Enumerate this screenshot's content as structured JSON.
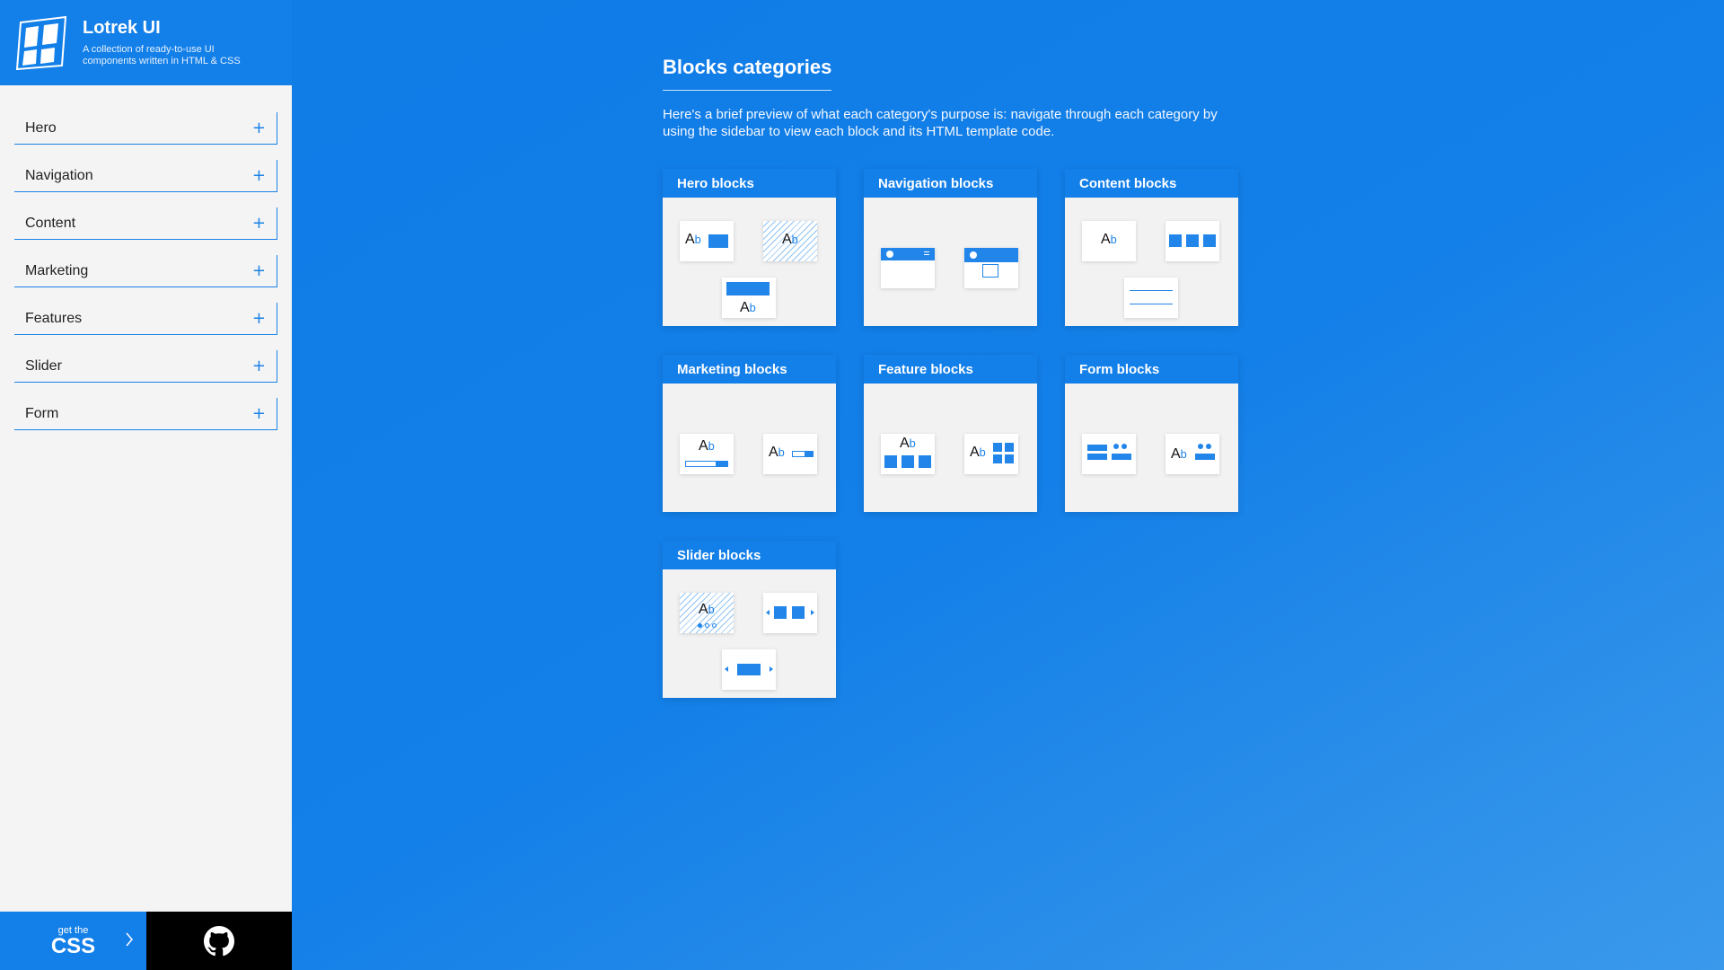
{
  "brand": {
    "title": "Lotrek UI",
    "subtitle": "A collection of ready-to-use UI components written in HTML & CSS"
  },
  "sidebar": {
    "items": [
      {
        "label": "Hero"
      },
      {
        "label": "Navigation"
      },
      {
        "label": "Content"
      },
      {
        "label": "Marketing"
      },
      {
        "label": "Features"
      },
      {
        "label": "Slider"
      },
      {
        "label": "Form"
      }
    ],
    "expand_symbol": "+"
  },
  "footer": {
    "get_small": "get the",
    "get_big": "CSS",
    "github_icon": "github-icon"
  },
  "main": {
    "title": "Blocks categories",
    "description": "Here's a brief preview of what each category's purpose is: navigate through each category by using the sidebar to view each block and its HTML template code."
  },
  "cards": [
    {
      "title": "Hero blocks"
    },
    {
      "title": "Navigation blocks"
    },
    {
      "title": "Content blocks"
    },
    {
      "title": "Marketing blocks"
    },
    {
      "title": "Feature blocks"
    },
    {
      "title": "Form blocks"
    },
    {
      "title": "Slider blocks"
    }
  ],
  "colors": {
    "accent": "#137fe8",
    "sidebar_bg": "#f4f4f4",
    "card_body": "#f2f2f2",
    "github_bg": "#000000"
  }
}
